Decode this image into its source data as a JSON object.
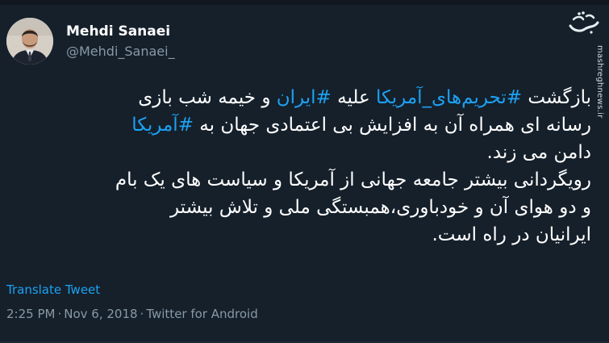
{
  "author": {
    "display_name": "Mehdi Sanaei",
    "handle": "@Mehdi_Sanaei_"
  },
  "tweet": {
    "lines": [
      [
        {
          "text": "بازگشت ",
          "hashtag": false
        },
        {
          "text": "#تحریم‌های_آمریکا",
          "hashtag": true
        },
        {
          "text": " علیه ",
          "hashtag": false
        },
        {
          "text": "#ایران",
          "hashtag": true
        },
        {
          "text": " و خیمه شب بازی",
          "hashtag": false
        }
      ],
      [
        {
          "text": "رسانه ای همراه آن به افزایش بی اعتمادی جهان به ",
          "hashtag": false
        },
        {
          "text": "#آمریکا",
          "hashtag": true
        }
      ],
      [
        {
          "text": "دامن می زند.",
          "hashtag": false
        }
      ],
      [
        {
          "text": "رویگردانی بیشتر جامعه جهانی از آمریکا و سیاست های یک بام",
          "hashtag": false
        }
      ],
      [
        {
          "text": "و دو هوای آن و خودباوری،همبستگی ملی و تلاش بیشتر",
          "hashtag": false
        }
      ],
      [
        {
          "text": "ایرانیان در راه است.",
          "hashtag": false
        }
      ]
    ]
  },
  "translate_label": "Translate Tweet",
  "meta": {
    "time": "2:25 PM",
    "separator": "·",
    "date": "Nov 6, 2018",
    "source": "Twitter for Android"
  },
  "watermark": {
    "logo_text": "مشرق",
    "site": "mashreghnews.ir"
  },
  "colors": {
    "background": "#15202b",
    "text": "#ffffff",
    "secondary": "#8899a6",
    "accent": "#1da1f2"
  },
  "icons": [
    "avatar-photo",
    "mashregh-logo"
  ]
}
